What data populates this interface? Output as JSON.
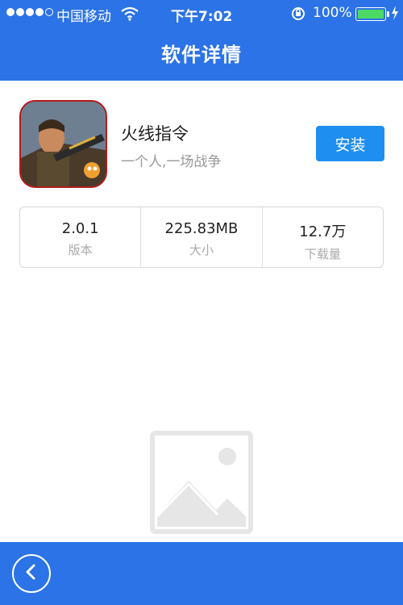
{
  "status": {
    "carrier": "中国移动",
    "time": "下午7:02",
    "battery": "100%"
  },
  "nav": {
    "title": "软件详情"
  },
  "app": {
    "name": "火线指令",
    "subtitle": "一个人,一场战争",
    "install_label": "安装",
    "icon": "game-icon"
  },
  "stats": [
    {
      "value": "2.0.1",
      "label": "版本"
    },
    {
      "value": "225.83MB",
      "label": "大小"
    },
    {
      "value": "12.7万",
      "label": "下载量"
    }
  ],
  "colors": {
    "primary": "#2b73e6",
    "button": "#1e8ef0",
    "battery": "#4cd964"
  }
}
